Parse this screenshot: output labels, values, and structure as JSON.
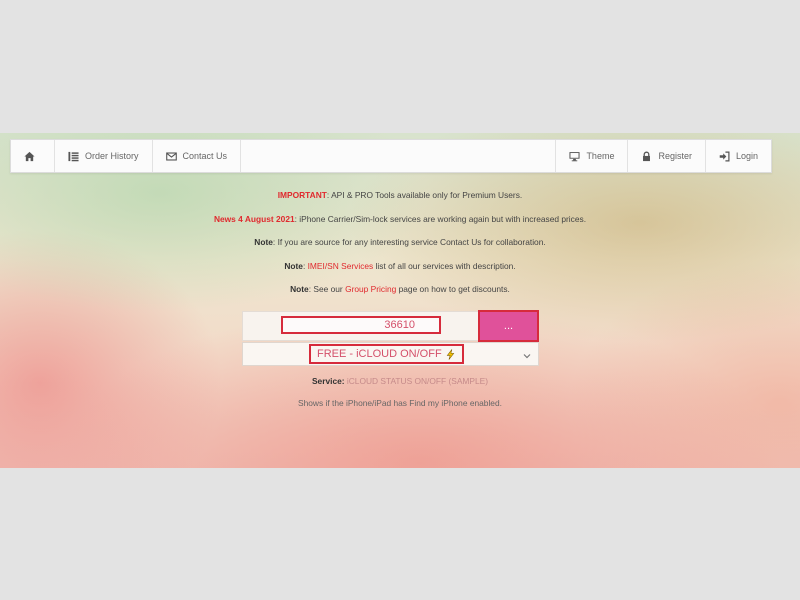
{
  "nav": {
    "left": [
      {
        "label": "",
        "icon": "home-icon"
      },
      {
        "label": "Order History",
        "icon": "list-icon"
      },
      {
        "label": "Contact Us",
        "icon": "envelope-icon"
      }
    ],
    "right": [
      {
        "label": "Theme",
        "icon": "monitor-icon"
      },
      {
        "label": "Register",
        "icon": "lock-icon"
      },
      {
        "label": "Login",
        "icon": "sign-in-icon"
      }
    ]
  },
  "notices": [
    {
      "strong": "IMPORTANT",
      "text": ": API & PRO Tools available only for Premium Users."
    },
    {
      "strong": "News 4 August 2021",
      "text": ": iPhone Carrier/Sim-lock services are working again but with increased prices."
    },
    {
      "strong": "Note",
      "text": ": If you are source for any interesting service Contact Us for collaboration."
    },
    {
      "strong": "Note",
      "pre": ": ",
      "link": "IMEI/SN Services",
      "post": " list of all our services with description."
    },
    {
      "strong": "Note",
      "pre": ": See our ",
      "link": "Group Pricing",
      "post": " page on how to get discounts."
    }
  ],
  "form": {
    "imei_value": "36610",
    "submit_label": "...",
    "selected_service": "FREE - iCLOUD ON/OFF",
    "selected_service_icon": "lightning-icon"
  },
  "service": {
    "label": "Service:",
    "value": "iCLOUD STATUS ON/OFF",
    "sample": "(SAMPLE)"
  },
  "description": "Shows if the iPhone/iPad has Find my iPhone enabled.",
  "colors": {
    "accent_red": "#e0292e",
    "button_pink": "#e0519a",
    "highlight_red": "#d62b3c"
  }
}
